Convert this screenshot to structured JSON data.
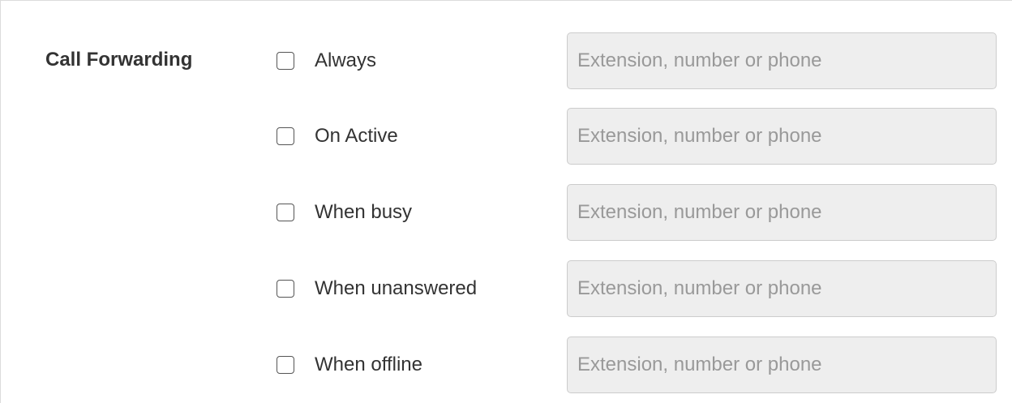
{
  "section": {
    "label": "Call Forwarding"
  },
  "options": [
    {
      "label": "Always",
      "checked": false,
      "placeholder": "Extension, number or phone"
    },
    {
      "label": "On Active",
      "checked": false,
      "placeholder": "Extension, number or phone"
    },
    {
      "label": "When busy",
      "checked": false,
      "placeholder": "Extension, number or phone"
    },
    {
      "label": "When unanswered",
      "checked": false,
      "placeholder": "Extension, number or phone"
    },
    {
      "label": "When offline",
      "checked": false,
      "placeholder": "Extension, number or phone"
    }
  ]
}
